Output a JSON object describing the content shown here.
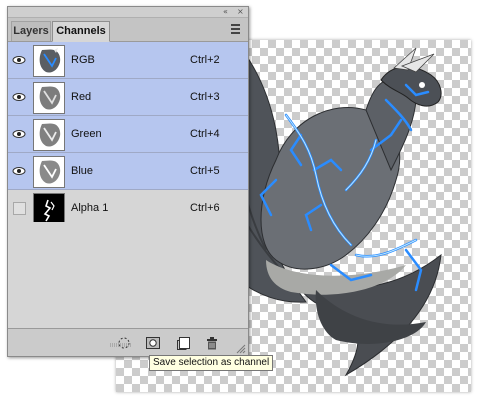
{
  "panel": {
    "collapse_glyph": "«",
    "close_glyph": "×",
    "tabs": [
      {
        "label": "Layers",
        "active": false
      },
      {
        "label": "Channels",
        "active": true
      }
    ]
  },
  "channels": [
    {
      "name": "RGB",
      "shortcut": "Ctrl+2",
      "visible": true,
      "selected": true,
      "thumb": "color"
    },
    {
      "name": "Red",
      "shortcut": "Ctrl+3",
      "visible": true,
      "selected": true,
      "thumb": "gray"
    },
    {
      "name": "Green",
      "shortcut": "Ctrl+4",
      "visible": true,
      "selected": true,
      "thumb": "gray"
    },
    {
      "name": "Blue",
      "shortcut": "Ctrl+5",
      "visible": true,
      "selected": true,
      "thumb": "gray"
    },
    {
      "name": "Alpha 1",
      "shortcut": "Ctrl+6",
      "visible": false,
      "selected": false,
      "thumb": "mask"
    }
  ],
  "bottom_buttons": [
    {
      "name": "load-channel-as-selection-icon"
    },
    {
      "name": "save-selection-as-channel-icon"
    },
    {
      "name": "create-new-channel-icon"
    },
    {
      "name": "delete-channel-icon"
    }
  ],
  "tooltip": "Save selection as channel",
  "colors": {
    "selected_row": "#b6c6ef",
    "panel_bg": "#d6d6d6",
    "lightning": "#2a8cff",
    "dragon_body": "#5f6369"
  }
}
